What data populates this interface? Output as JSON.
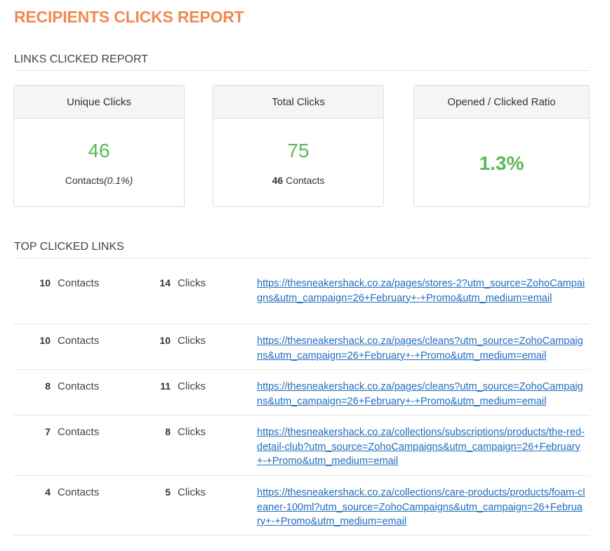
{
  "page_title": "RECIPIENTS CLICKS REPORT",
  "links_clicked_section": {
    "heading": "LINKS CLICKED REPORT",
    "unique_clicks": {
      "title": "Unique Clicks",
      "value": "46",
      "sub_label": "Contacts",
      "sub_percent": "(0.1%)"
    },
    "total_clicks": {
      "title": "Total Clicks",
      "value": "75",
      "sub_count": "46",
      "sub_label": "Contacts"
    },
    "open_click_ratio": {
      "title": "Opened / Clicked Ratio",
      "value": "1.3%"
    }
  },
  "top_links_section": {
    "heading": "TOP CLICKED LINKS",
    "rows": [
      {
        "contacts": "10",
        "contacts_label": "Contacts",
        "clicks": "14",
        "clicks_label": "Clicks",
        "url": "https://thesneakershack.co.za/pages/stores-2?utm_source=ZohoCampaigns&utm_campaign=26+February+-+Promo&utm_medium=email"
      },
      {
        "contacts": "10",
        "contacts_label": "Contacts",
        "clicks": "10",
        "clicks_label": "Clicks",
        "url": "https://thesneakershack.co.za/pages/cleans?utm_source=ZohoCampaigns&utm_campaign=26+February+-+Promo&utm_medium=email"
      },
      {
        "contacts": "8",
        "contacts_label": "Contacts",
        "clicks": "11",
        "clicks_label": "Clicks",
        "url": "https://thesneakershack.co.za/pages/cleans?utm_source=ZohoCampaigns&utm_campaign=26+February+-+Promo&utm_medium=email"
      },
      {
        "contacts": "7",
        "contacts_label": "Contacts",
        "clicks": "8",
        "clicks_label": "Clicks",
        "url": "https://thesneakershack.co.za/collections/subscriptions/products/the-red-detail-club?utm_source=ZohoCampaigns&utm_campaign=26+February+-+Promo&utm_medium=email"
      },
      {
        "contacts": "4",
        "contacts_label": "Contacts",
        "clicks": "5",
        "clicks_label": "Clicks",
        "url": "https://thesneakershack.co.za/collections/care-products/products/foam-cleaner-100ml?utm_source=ZohoCampaigns&utm_campaign=26+February+-+Promo&utm_medium=email"
      }
    ]
  },
  "colors": {
    "title_orange": "#f08a53",
    "metric_green": "#5cb85c",
    "link_blue": "#1f6ebd"
  }
}
